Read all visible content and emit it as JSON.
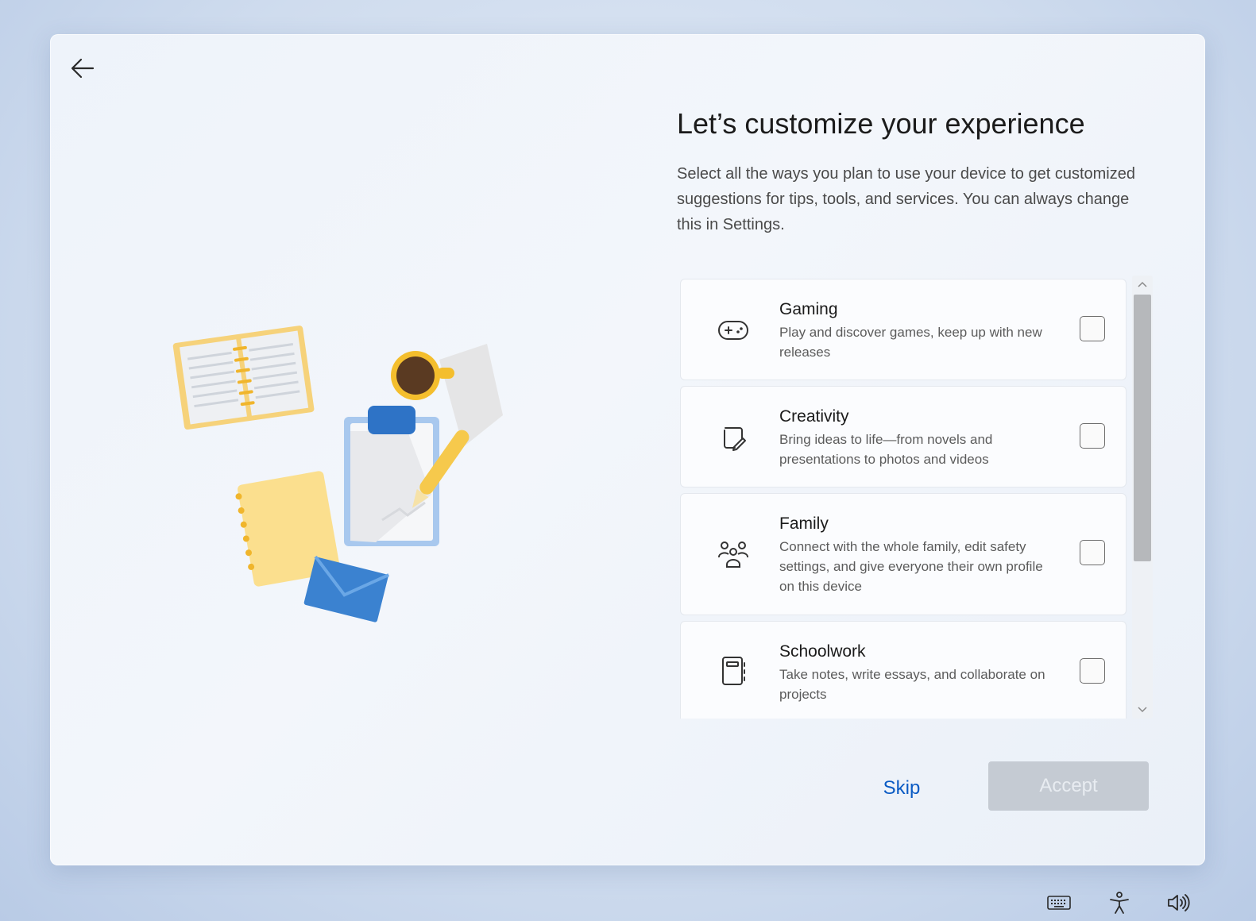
{
  "header": {
    "title": "Let’s customize your experience",
    "subtitle": "Select all the ways you plan to use your device to get customized suggestions for tips, tools, and services. You can always change this in Settings."
  },
  "options": [
    {
      "title": "Gaming",
      "description": "Play and discover games, keep up with new releases",
      "icon": "gamepad-icon",
      "checked": false
    },
    {
      "title": "Creativity",
      "description": "Bring ideas to life—from novels and presentations to photos and videos",
      "icon": "pen-paper-icon",
      "checked": false
    },
    {
      "title": "Family",
      "description": "Connect with the whole family, edit safety settings, and give everyone their own profile on this device",
      "icon": "people-icon",
      "checked": false
    },
    {
      "title": "Schoolwork",
      "description": "Take notes, write essays, and collaborate on projects",
      "icon": "notebook-icon",
      "checked": false
    }
  ],
  "footer": {
    "skip_label": "Skip",
    "accept_label": "Accept",
    "accept_enabled": false
  },
  "tray": {
    "icons": [
      "keyboard-icon",
      "accessibility-icon",
      "volume-icon"
    ]
  },
  "colors": {
    "link": "#0a5bc4",
    "disabled_button": "#c5cbd3"
  }
}
